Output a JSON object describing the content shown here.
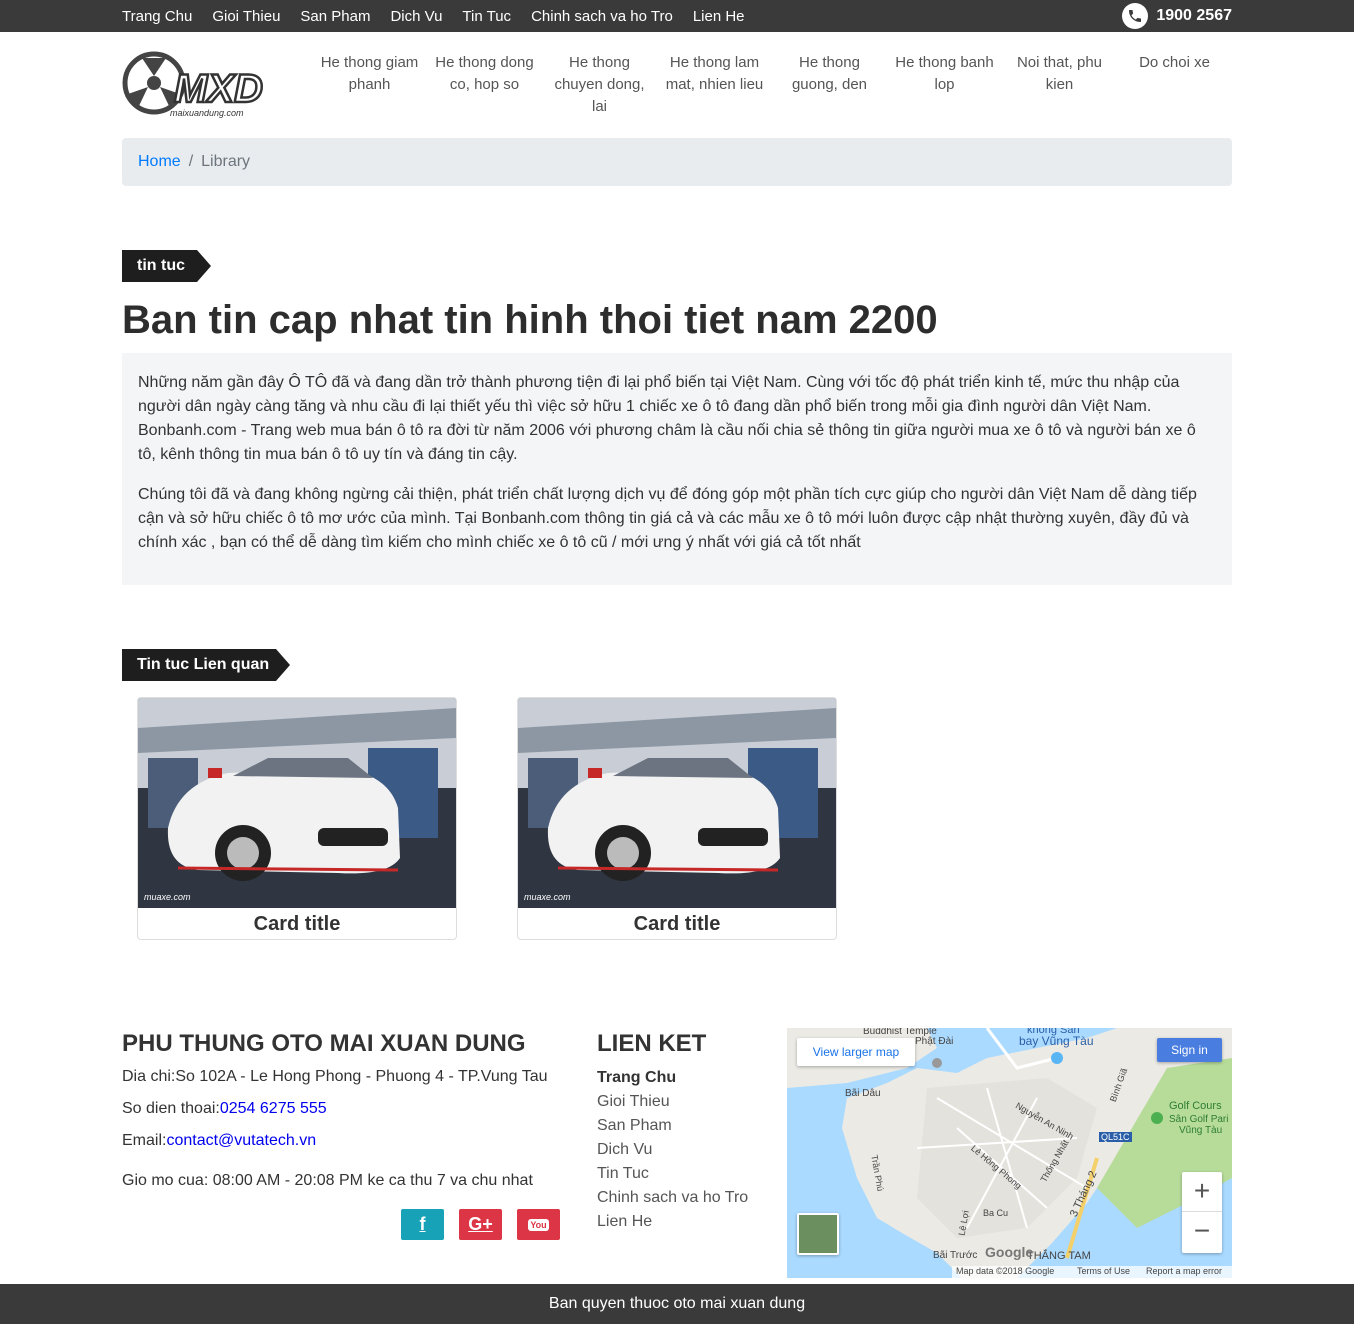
{
  "topnav": [
    "Trang Chu",
    "Gioi Thieu",
    "San Pham",
    "Dich Vu",
    "Tin Tuc",
    "Chinh sach va ho Tro",
    "Lien He"
  ],
  "phone": "1900 2567",
  "logo": {
    "text": "MXD",
    "subtext": "maixuandung.com"
  },
  "catnav": [
    "He thong giam phanh",
    "He thong dong co, hop so",
    "He thong chuyen dong, lai",
    "He thong lam mat, nhien lieu",
    "He thong guong, den",
    "He thong banh lop",
    "Noi that, phu kien",
    "Do choi xe"
  ],
  "breadcrumb": {
    "home": "Home",
    "current": "Library",
    "separator": "/"
  },
  "article": {
    "tag": "tin tuc",
    "title": "Ban tin cap nhat tin hinh thoi tiet nam 2200",
    "paragraphs": [
      "Những năm gần đây Ô TÔ đã và đang dần trở thành phương tiện đi lại phổ biến tại Việt Nam. Cùng với tốc độ phát triển kinh tế, mức thu nhập của người dân ngày càng tăng và nhu cầu đi lại thiết yếu thì việc sở hữu 1 chiếc xe ô tô đang dần phổ biến trong mỗi gia đình người dân Việt Nam. Bonbanh.com - Trang web mua bán ô tô ra đời từ năm 2006 với phương châm là cầu nối chia sẻ thông tin giữa người mua xe ô tô và người bán xe ô tô, kênh thông tin mua bán ô tô uy tín và đáng tin cậy.",
      "Chúng tôi đã và đang không ngừng cải thiện, phát triển chất lượng dịch vụ để đóng góp một phần tích cực giúp cho người dân Việt Nam dễ dàng tiếp cận và sở hữu chiếc ô tô mơ ước của mình. Tại Bonbanh.com thông tin giá cả và các mẫu xe ô tô mới luôn được cập nhật thường xuyên, đầy đủ và chính xác , bạn có thể dễ dàng tìm kiếm cho mình chiếc xe ô tô cũ / mới ưng ý nhất với giá cả tốt nhất"
    ]
  },
  "related": {
    "tag": "Tin tuc Lien quan",
    "cards": [
      {
        "title": "Card title"
      },
      {
        "title": "Card title"
      }
    ]
  },
  "footer": {
    "company": "PHU THUNG OTO MAI XUAN DUNG",
    "address_label": "Dia chi:",
    "address": "So 102A - Le Hong Phong - Phuong 4 - TP.Vung Tau",
    "phone_label": "So dien thoai:",
    "phone": "0254 6275 555",
    "email_label": "Email:",
    "email": "contact@vutatech.vn",
    "hours": "Gio mo cua: 08:00 AM - 20:08 PM ke ca thu 7 va chu nhat",
    "social": [
      {
        "name": "facebook",
        "glyph": "f",
        "color": "#17a2b8"
      },
      {
        "name": "google-plus",
        "glyph": "G+",
        "color": "#dc3545"
      },
      {
        "name": "youtube",
        "glyph": "You",
        "color": "#dc3545"
      }
    ],
    "links_title": "LIEN KET",
    "links": [
      "Trang Chu",
      "Gioi Thieu",
      "San Pham",
      "Dich Vu",
      "Tin Tuc",
      "Chinh sach va ho Tro",
      "Lien He"
    ],
    "map": {
      "view_larger": "View larger map",
      "sign_in": "Sign in",
      "attribution": "Map data ©2018 Google",
      "terms": "Terms of Use",
      "report": "Report a map error",
      "google": "Google",
      "labels": [
        "Buddhist Temple",
        "Phật Đài",
        "khong Sân",
        "bay Vũng Tàu",
        "Bãi Dâu",
        "Golf Cours",
        "Sân Golf Pari",
        "Vũng Tàu",
        "Nguyễn An Ninh",
        "QL51C",
        "Trần Phú",
        "Lê Hồng Phong",
        "Thống Nhất",
        "3 Tháng 2",
        "Ba Cu",
        "Lê Lợi",
        "Bãi Trước",
        "THẮNG TAM",
        "Bình Giã"
      ]
    }
  },
  "copyright": "Ban quyen thuoc oto mai xuan dung"
}
